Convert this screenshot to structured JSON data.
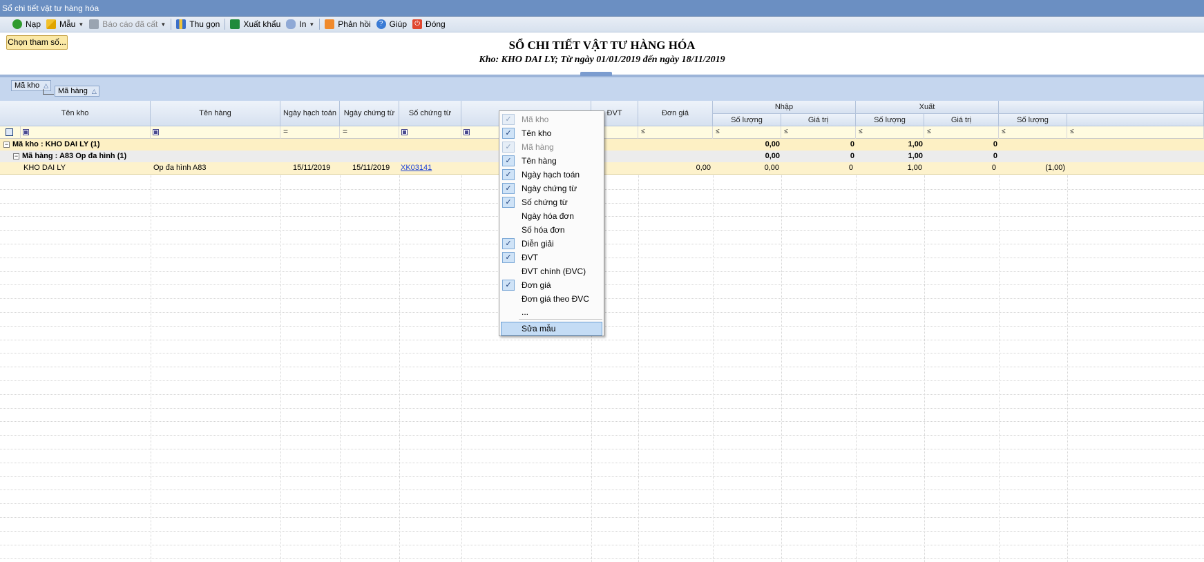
{
  "window": {
    "title": "Sổ chi tiết vật tư hàng hóa"
  },
  "toolbar": {
    "items": [
      {
        "label": "Nạp",
        "icon": "refresh-icon"
      },
      {
        "label": "Mẫu",
        "icon": "template-icon"
      },
      {
        "label": "Báo cáo đã cất",
        "icon": "save-icon"
      },
      {
        "label": "Thu gọn",
        "icon": "collapse-icon"
      },
      {
        "label": "Xuất khẩu",
        "icon": "excel-icon"
      },
      {
        "label": "In",
        "icon": "print-icon"
      },
      {
        "label": "Phản hồi",
        "icon": "feedback-icon"
      },
      {
        "label": "Giúp",
        "icon": "help-icon"
      },
      {
        "label": "Đóng",
        "icon": "close-icon"
      }
    ]
  },
  "params": {
    "button_label": "Chọn tham số..."
  },
  "report": {
    "title": "SỔ CHI TIẾT VẬT TƯ HÀNG HÓA",
    "subtitle": "Kho: KHO DAI LY; Từ ngày 01/01/2019 đến ngày 18/11/2019"
  },
  "grouping": {
    "chips": [
      "Mã kho",
      "Mã hàng"
    ]
  },
  "grid": {
    "headers": {
      "ten_kho": "Tên kho",
      "ten_hang": "Tên hàng",
      "ngay_hach_toan": "Ngày hạch toán",
      "ngay_chung_tu": "Ngày chứng từ",
      "so_chung_tu": "Số chứng từ",
      "dvt": "ĐVT",
      "don_gia": "Đơn giá",
      "nhap": "Nhập",
      "xuat": "Xuất",
      "so_luong": "Số lượng",
      "gia_tri": "Giá trị"
    },
    "filter_ops": {
      "le": "≤",
      "eq": "="
    },
    "group1": {
      "label": "Mã kho : KHO DAI LY (1)",
      "nhap_sl": "0,00",
      "nhap_gt": "0",
      "xuat_sl": "1,00",
      "xuat_gt": "0"
    },
    "group2": {
      "label": "Mã hàng :  A83 Op đa hình  (1)",
      "nhap_sl": "0,00",
      "nhap_gt": "0",
      "xuat_sl": "1,00",
      "xuat_gt": "0"
    },
    "row": {
      "ten_kho": "KHO DAI LY",
      "ten_hang": "Op đa hình   A83",
      "ngay_hach_toan": "15/11/2019",
      "ngay_chung_tu": "15/11/2019",
      "so_chung_tu": "XK03141",
      "don_gia": "0,00",
      "nhap_sl": "0,00",
      "nhap_gt": "0",
      "xuat_sl": "1,00",
      "xuat_gt": "0",
      "ton_sl": "(1,00)"
    }
  },
  "context_menu": {
    "items": [
      {
        "label": "Mã kho",
        "checked": true,
        "disabled": true
      },
      {
        "label": "Tên kho",
        "checked": true,
        "disabled": false
      },
      {
        "label": "Mã hàng",
        "checked": true,
        "disabled": true
      },
      {
        "label": "Tên hàng",
        "checked": true,
        "disabled": false
      },
      {
        "label": "Ngày hạch toán",
        "checked": true,
        "disabled": false
      },
      {
        "label": "Ngày chứng từ",
        "checked": true,
        "disabled": false
      },
      {
        "label": "Số chứng từ",
        "checked": true,
        "disabled": false
      },
      {
        "label": "Ngày hóa đơn",
        "checked": false,
        "disabled": false
      },
      {
        "label": "Số hóa đơn",
        "checked": false,
        "disabled": false
      },
      {
        "label": "Diễn giải",
        "checked": true,
        "disabled": false
      },
      {
        "label": "ĐVT",
        "checked": true,
        "disabled": false
      },
      {
        "label": "ĐVT chính (ĐVC)",
        "checked": false,
        "disabled": false
      },
      {
        "label": "Đơn giá",
        "checked": true,
        "disabled": false
      },
      {
        "label": "Đơn giá theo ĐVC",
        "checked": false,
        "disabled": false
      },
      {
        "label": "...",
        "checked": false,
        "disabled": false
      }
    ],
    "edit_label": "Sửa mẫu",
    "check_glyph": "✓"
  }
}
